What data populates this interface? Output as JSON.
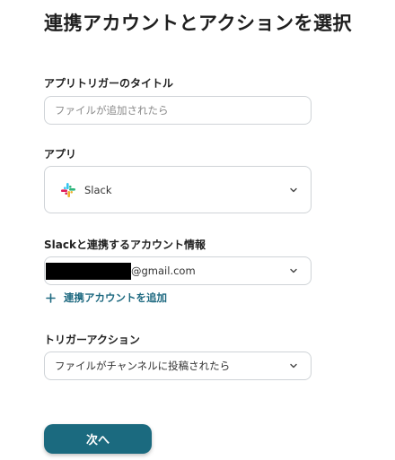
{
  "page": {
    "title": "連携アカウントとアクションを選択"
  },
  "trigger_title": {
    "label": "アプリトリガーのタイトル",
    "value": "",
    "placeholder": "ファイルが追加されたら"
  },
  "app": {
    "label": "アプリ",
    "selected": "Slack",
    "icon": "slack-logo"
  },
  "account": {
    "label": "Slackと連携するアカウント情報",
    "email_suffix": "@gmail.com",
    "add_link_label": "連携アカウントを追加",
    "add_icon": "plus-icon"
  },
  "trigger_action": {
    "label": "トリガーアクション",
    "selected": "ファイルがチャンネルに投稿されたら"
  },
  "next_button": {
    "label": "次へ"
  },
  "colors": {
    "primary": "#1b6a7f",
    "link": "#1f6a81",
    "border": "#cfd3d7",
    "slack_blue": "#36C5F0",
    "slack_green": "#2EB67D",
    "slack_red": "#E01E5A",
    "slack_yellow": "#ECB22E"
  }
}
